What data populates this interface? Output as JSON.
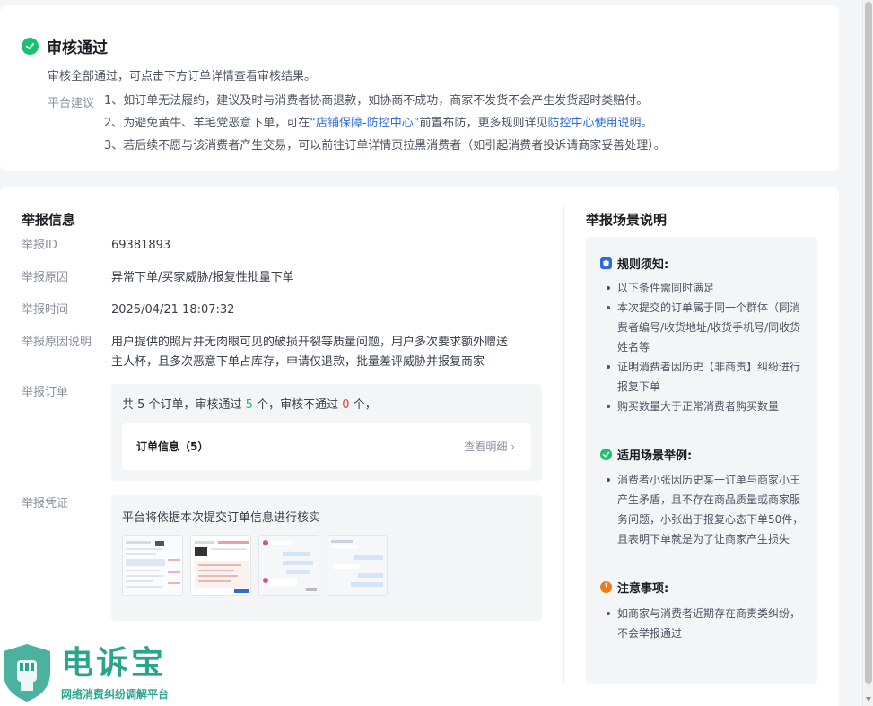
{
  "status": {
    "title": "审核通过",
    "desc": "审核全部通过，可点击下方订单详情查看审核结果。"
  },
  "advice": {
    "label": "平台建议",
    "line1": "1、如订单无法履约，建议及时与消费者协商退款，如协商不成功，商家不发货不会产生发货超时类赔付。",
    "line2_a": "2、为避免黄牛、羊毛党恶意下单，可在",
    "line2_link1": "“店铺保障-防控中心”",
    "line2_b": "前置布防，更多规则详见",
    "line2_link2": "防控中心使用说明",
    "line2_c": "。",
    "line3": "3、若后续不愿与该消费者产生交易，可以前往订单详情页拉黑消费者（如引起消费者投诉请商家妥善处理）。"
  },
  "report": {
    "title": "举报信息",
    "id_label": "举报ID",
    "id_value": "69381893",
    "reason_label": "举报原因",
    "reason_value": "异常下单/买家威胁/报复性批量下单",
    "time_label": "举报时间",
    "time_value": "2025/04/21 18:07:32",
    "explain_label": "举报原因说明",
    "explain_line1": "用户提供的照片并无肉眼可见的破损开裂等质量问题，用户多次要求额外赠送",
    "explain_line2": "主人杯，且多次恶意下单占库存，申请仅退款，批量差评威胁并报复商家",
    "orders_label": "举报订单",
    "orders_total_pre": "共 5 个订单，审核通过 ",
    "orders_pass": "5",
    "orders_mid": " 个，审核不通过 ",
    "orders_fail": "0",
    "orders_end": " 个，",
    "order_info": "订单信息（5）",
    "order_detail": "查看明细",
    "evidence_label": "举报凭证",
    "evidence_text": "平台将依据本次提交订单信息进行核实"
  },
  "scene": {
    "title": "举报场景说明",
    "rules_title": "规则须知:",
    "rules": [
      "以下条件需同时满足",
      "本次提交的订单属于同一个群体（同消费者编号/收货地址/收货手机号/同收货姓名等",
      "证明消费者因历史【非商责】纠纷进行报复下单",
      "购买数量大于正常消费者购买数量"
    ],
    "example_title": "适用场景举例:",
    "examples": [
      "消费者小张因历史某一订单与商家小王产生矛盾，且不存在商品质量或商家服务问题，小张出于报复心态下单50件，且表明下单就是为了让商家产生损失"
    ],
    "notice_title": "注意事项:",
    "notices": [
      "如商家与消费者近期存在商责类纠纷，不会举报通过"
    ]
  },
  "watermark": {
    "title": "电诉宝",
    "subtitle": "网络消费纠纷调解平台"
  },
  "colors": {
    "success": "#1dbf73",
    "link": "#2d6bdb",
    "fail": "#e53935",
    "brand": "#2aa58d"
  }
}
